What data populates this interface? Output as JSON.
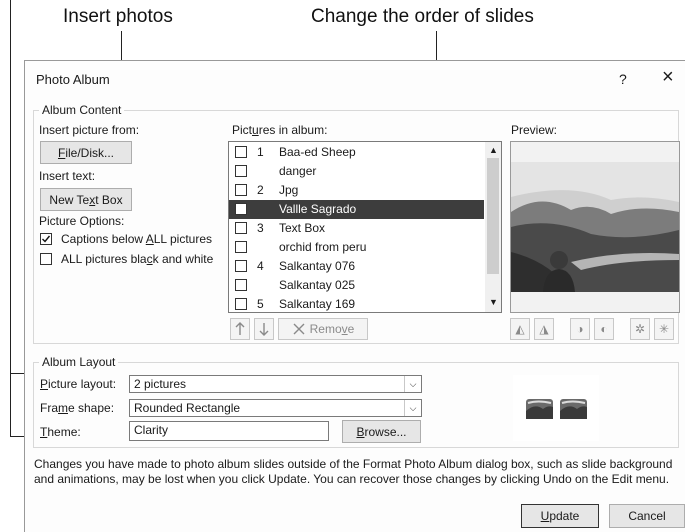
{
  "callouts": {
    "insert_photos": "Insert photos",
    "change_order": "Change the order of slides"
  },
  "dialog": {
    "title": "Photo Album",
    "help_label": "?",
    "close_label": "×",
    "album_content_title": "Album Content",
    "insert_picture_from_label": "Insert picture from:",
    "file_disk_label": "File/Disk...",
    "insert_text_label": "Insert text:",
    "new_text_box_label": "New Text Box",
    "picture_options_label": "Picture Options:",
    "captions_label": "Captions below ALL pictures",
    "captions_checked": true,
    "bw_label": "ALL pictures black and white",
    "bw_checked": false,
    "pictures_in_album_label": "Pictures in album:",
    "preview_label": "Preview:",
    "album_items": [
      {
        "num": "1",
        "name": "Baa-ed Sheep",
        "selected": false
      },
      {
        "num": "",
        "name": "danger",
        "selected": false
      },
      {
        "num": "2",
        "name": "Jpg",
        "selected": false
      },
      {
        "num": "",
        "name": "Vallle Sagrado",
        "selected": true
      },
      {
        "num": "3",
        "name": "Text Box",
        "selected": false
      },
      {
        "num": "",
        "name": "orchid from peru",
        "selected": false
      },
      {
        "num": "4",
        "name": "Salkantay 076",
        "selected": false
      },
      {
        "num": "",
        "name": "Salkantay 025",
        "selected": false
      },
      {
        "num": "5",
        "name": "Salkantay 169",
        "selected": false
      }
    ],
    "move_up_icon": "arrow-up-icon",
    "move_down_icon": "arrow-down-icon",
    "remove_label": "Remove",
    "album_layout_title": "Album Layout",
    "picture_layout_label": "Picture layout:",
    "picture_layout_value": "2 pictures",
    "frame_shape_label": "Frame shape:",
    "frame_shape_value": "Rounded Rectangle",
    "theme_label": "Theme:",
    "theme_value": "Clarity",
    "browse_label": "Browse...",
    "notice": "Changes you have made to photo album slides outside of the Format Photo Album dialog box, such as slide background and animations, may be lost when you click Update. You can recover those changes by clicking Undo on the Edit menu.",
    "update_label": "Update",
    "cancel_label": "Cancel"
  }
}
